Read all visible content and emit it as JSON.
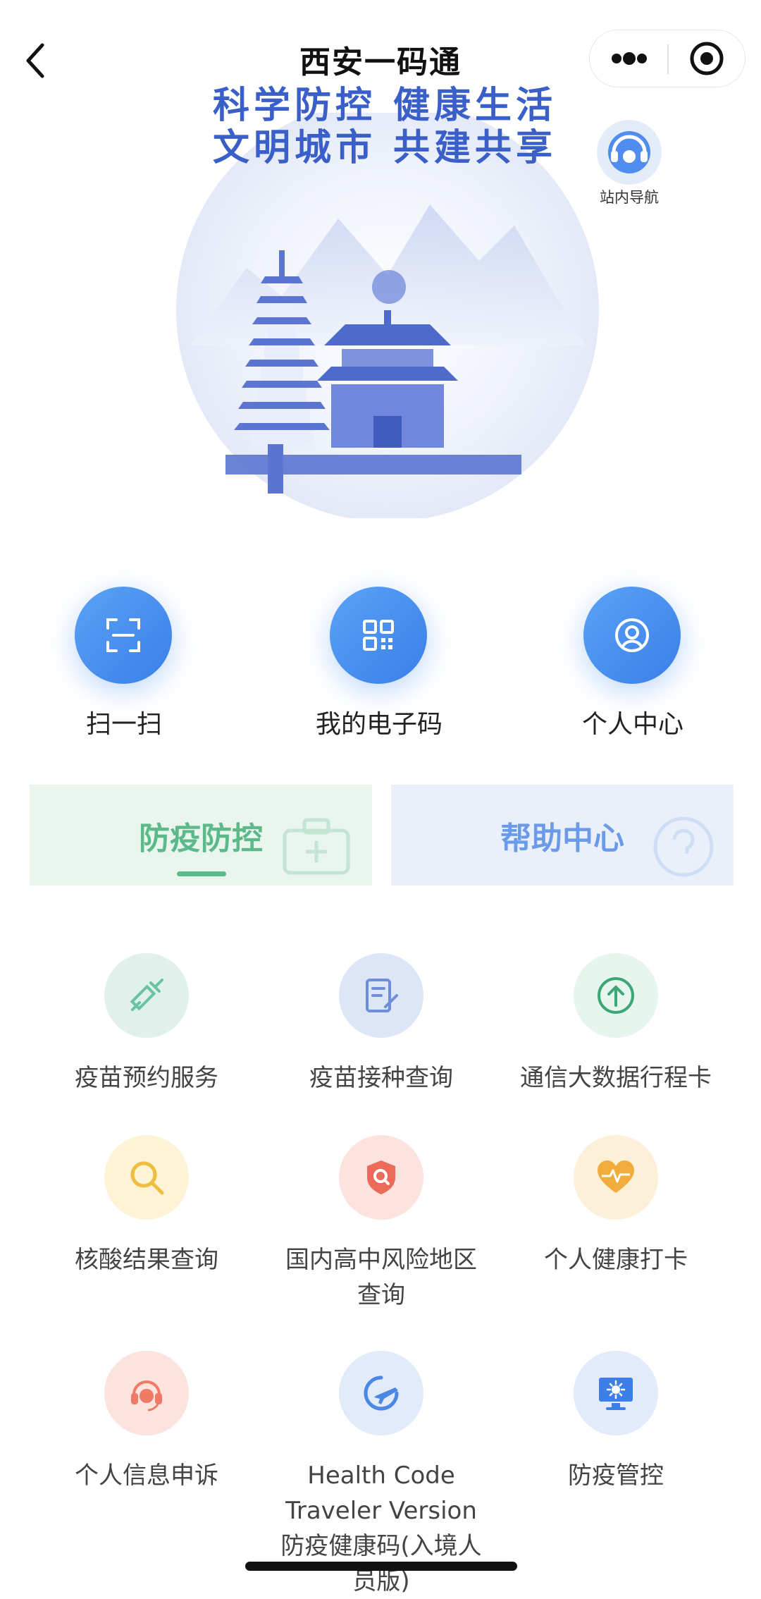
{
  "header": {
    "title": "西安一码通"
  },
  "banner": {
    "slogan_line1": "科学防控 健康生活",
    "slogan_line2": "文明城市 共建共享",
    "nav_help_label": "站内导航"
  },
  "actions": [
    {
      "label": "扫一扫",
      "icon": "scan-icon"
    },
    {
      "label": "我的电子码",
      "icon": "qr-code-icon"
    },
    {
      "label": "个人中心",
      "icon": "user-icon"
    }
  ],
  "tabs": [
    {
      "label": "防疫防控",
      "selected": true
    },
    {
      "label": "帮助中心",
      "selected": false
    }
  ],
  "services": [
    {
      "label": "疫苗预约服务",
      "icon": "syringe-icon",
      "bg": "#dff1ea",
      "fg": "#69c2a0"
    },
    {
      "label": "疫苗接种查询",
      "icon": "document-edit-icon",
      "bg": "#dde6f6",
      "fg": "#6e8fd8"
    },
    {
      "label": "通信大数据行程卡",
      "icon": "arrow-up-circle-icon",
      "bg": "#e6f6ee",
      "fg": "#3aa775"
    },
    {
      "label": "核酸结果查询",
      "icon": "magnifier-icon",
      "bg": "#fdf3d6",
      "fg": "#f0bd3e"
    },
    {
      "label": "国内高中风险地区查询",
      "icon": "shield-search-icon",
      "bg": "#fde3de",
      "fg": "#ec6a5a"
    },
    {
      "label": "个人健康打卡",
      "icon": "heartbeat-icon",
      "bg": "#fdf0d8",
      "fg": "#f2ac3c"
    },
    {
      "label": "个人信息申诉",
      "icon": "headset-icon",
      "bg": "#fde3de",
      "fg": "#ef7a65"
    },
    {
      "label": "Health Code Traveler Version防疫健康码(入境人员版)",
      "icon": "airplane-icon",
      "bg": "#e1ebf9",
      "fg": "#4a88e3"
    },
    {
      "label": "防疫管控",
      "icon": "monitor-virus-icon",
      "bg": "#e1ebf9",
      "fg": "#3d7fe6"
    }
  ],
  "colors": {
    "accent_blue": "#3a7fe8",
    "accent_green": "#5cb98a"
  }
}
